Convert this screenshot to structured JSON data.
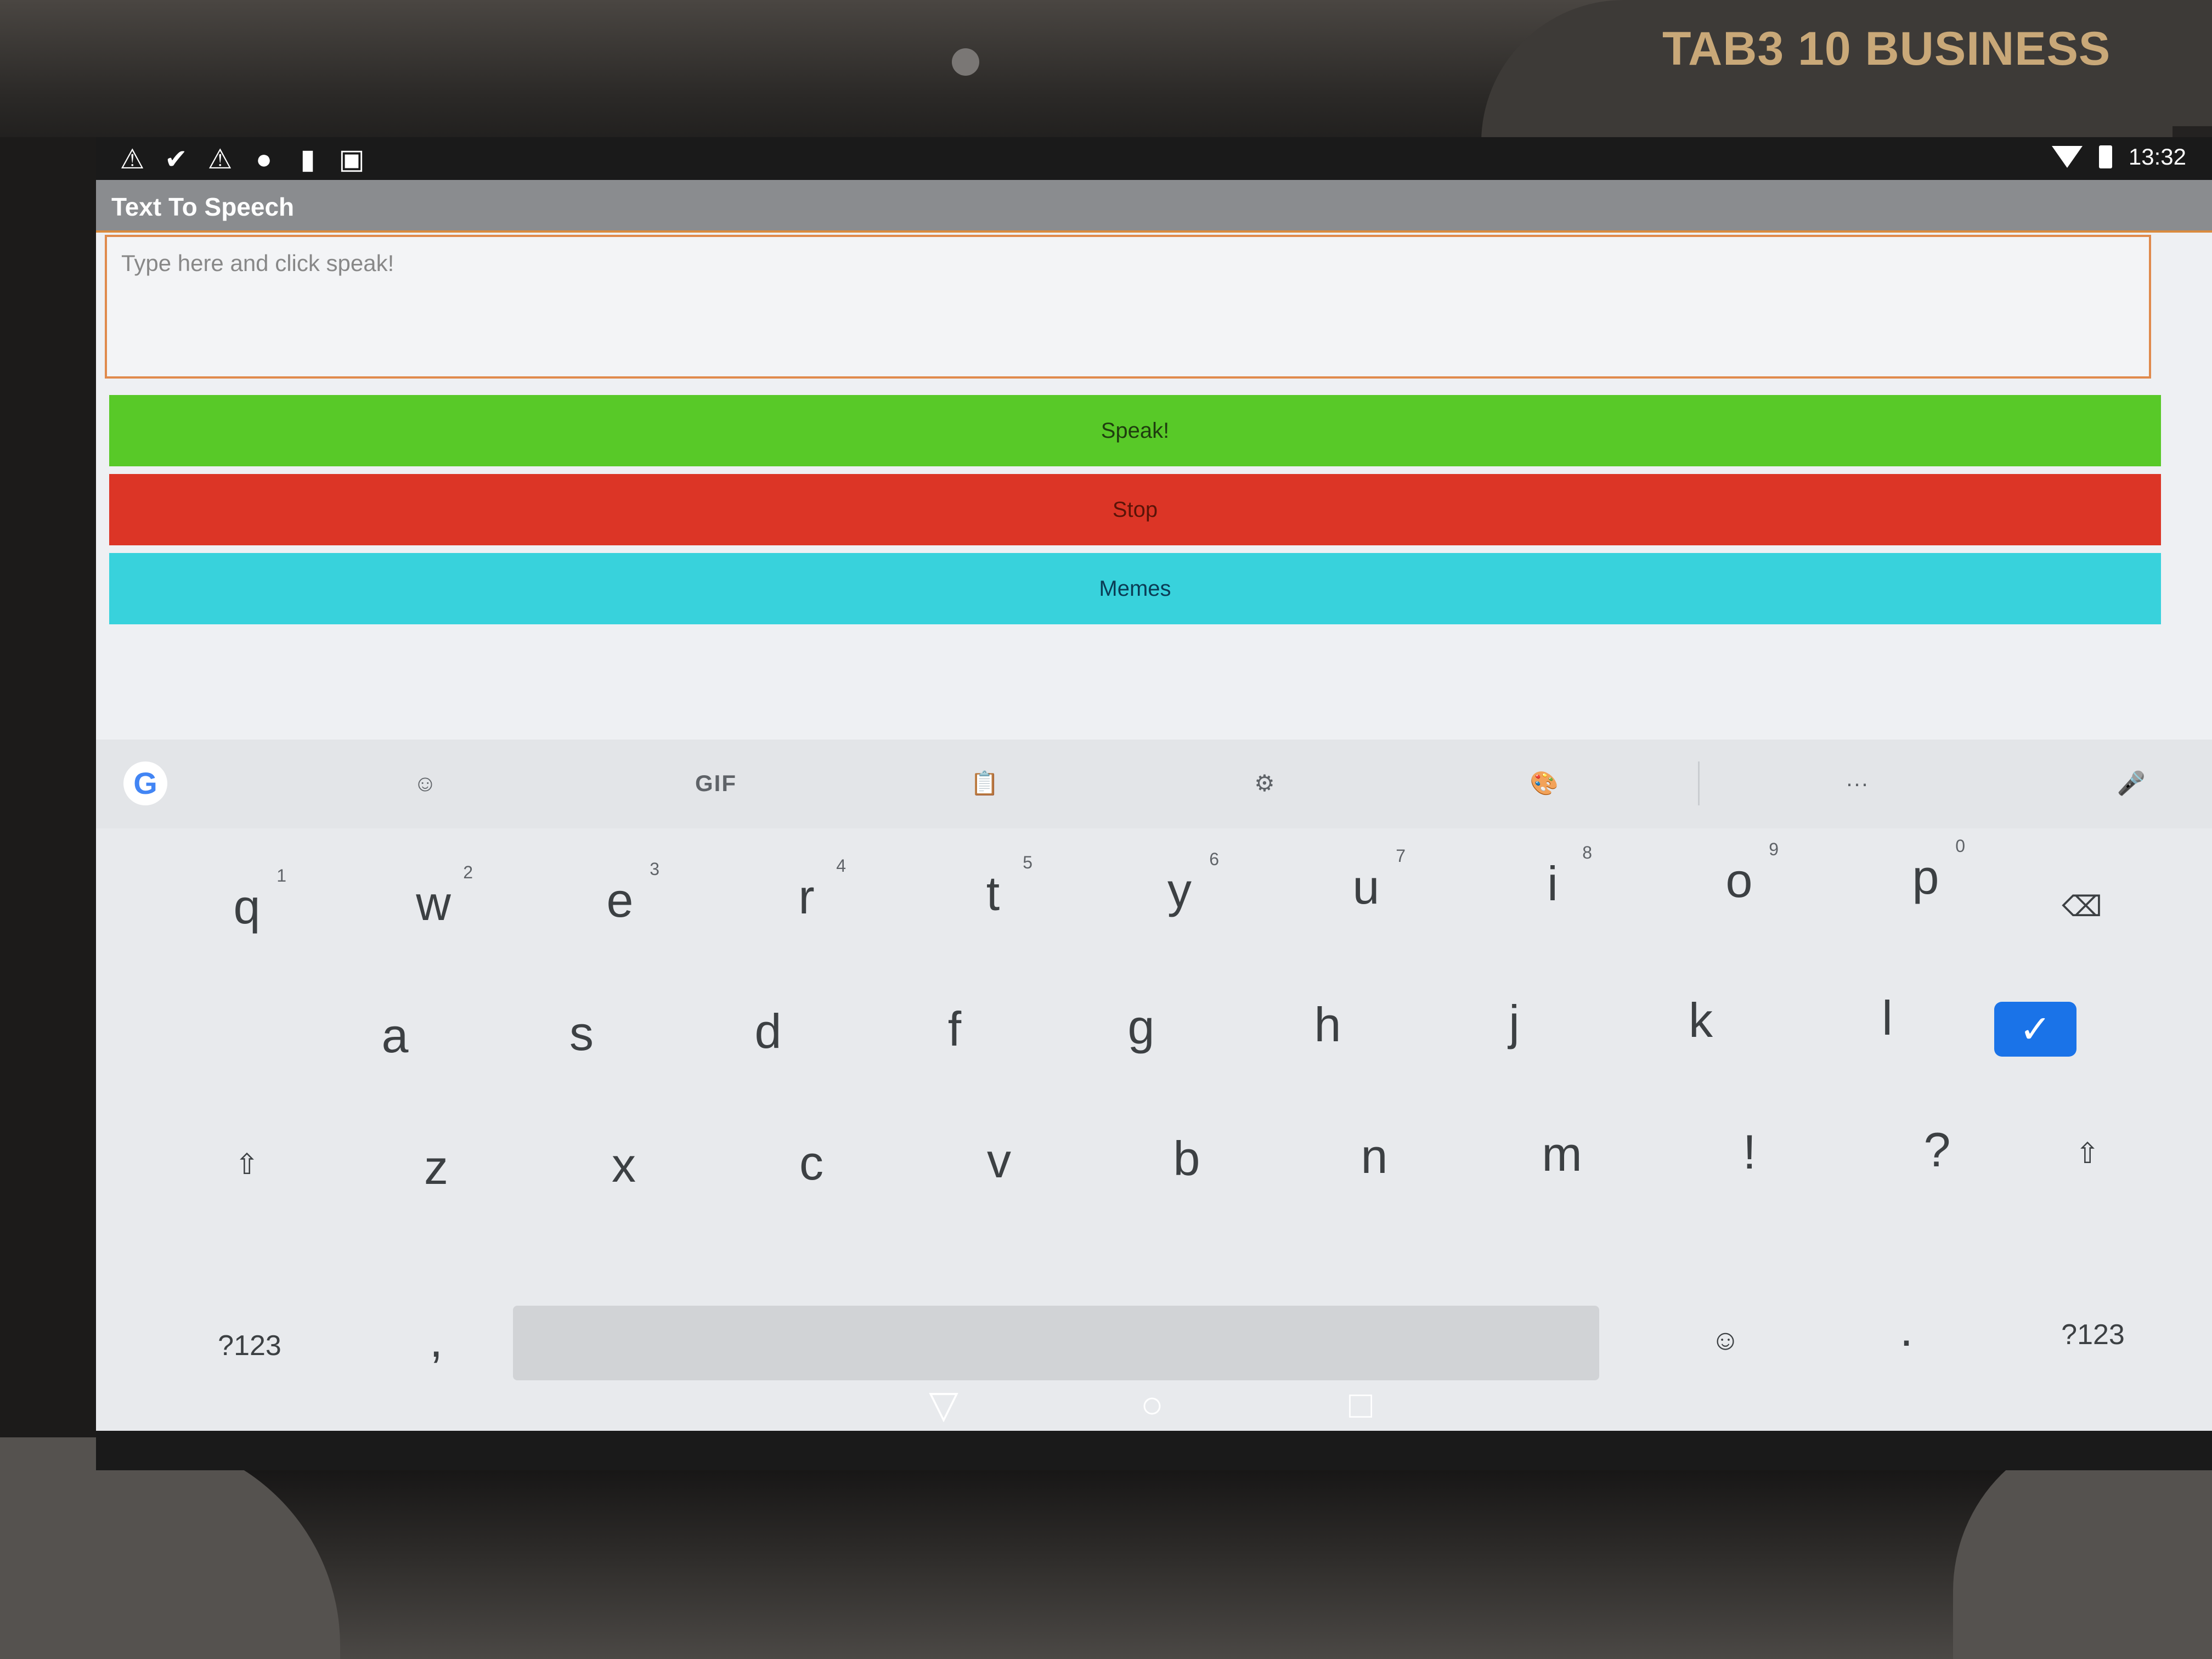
{
  "device": {
    "brand_label": "TAB3 10 BUSINESS"
  },
  "status_bar": {
    "left_icons": [
      "warning-icon",
      "check-icon",
      "warning-icon",
      "circle-icon",
      "sd-card-icon",
      "image-icon"
    ],
    "time": "13:32"
  },
  "app_bar": {
    "title": "Text To Speech"
  },
  "input": {
    "placeholder": "Type here and click speak!",
    "value": ""
  },
  "buttons": {
    "speak": "Speak!",
    "stop": "Stop",
    "memes": "Memes"
  },
  "colors": {
    "speak_bg": "#58c928",
    "stop_bg": "#dc3526",
    "memes_bg": "#38d2dc",
    "input_border": "#e08a4c",
    "enter_key_bg": "#1a73e8"
  },
  "keyboard": {
    "suggestion_bar": {
      "google": "G",
      "gif": "GIF",
      "more": "···",
      "icons": [
        "google-icon",
        "sticker-icon",
        "gif-icon",
        "clipboard-icon",
        "settings-icon",
        "palette-icon",
        "more-icon",
        "microphone-icon"
      ]
    },
    "row1": [
      {
        "key": "q",
        "hint": "1"
      },
      {
        "key": "w",
        "hint": "2"
      },
      {
        "key": "e",
        "hint": "3"
      },
      {
        "key": "r",
        "hint": "4"
      },
      {
        "key": "t",
        "hint": "5"
      },
      {
        "key": "y",
        "hint": "6"
      },
      {
        "key": "u",
        "hint": "7"
      },
      {
        "key": "i",
        "hint": "8"
      },
      {
        "key": "o",
        "hint": "9"
      },
      {
        "key": "p",
        "hint": "0"
      }
    ],
    "row2": [
      "a",
      "s",
      "d",
      "f",
      "g",
      "h",
      "j",
      "k",
      "l"
    ],
    "row3": [
      "z",
      "x",
      "c",
      "v",
      "b",
      "n",
      "m",
      "!",
      "?"
    ],
    "row4": {
      "symbols_left": "?123",
      "comma": ",",
      "period": ".",
      "symbols_right": "?123"
    }
  },
  "nav_bar": {
    "icons": [
      "back-icon",
      "home-icon",
      "recents-icon"
    ]
  }
}
